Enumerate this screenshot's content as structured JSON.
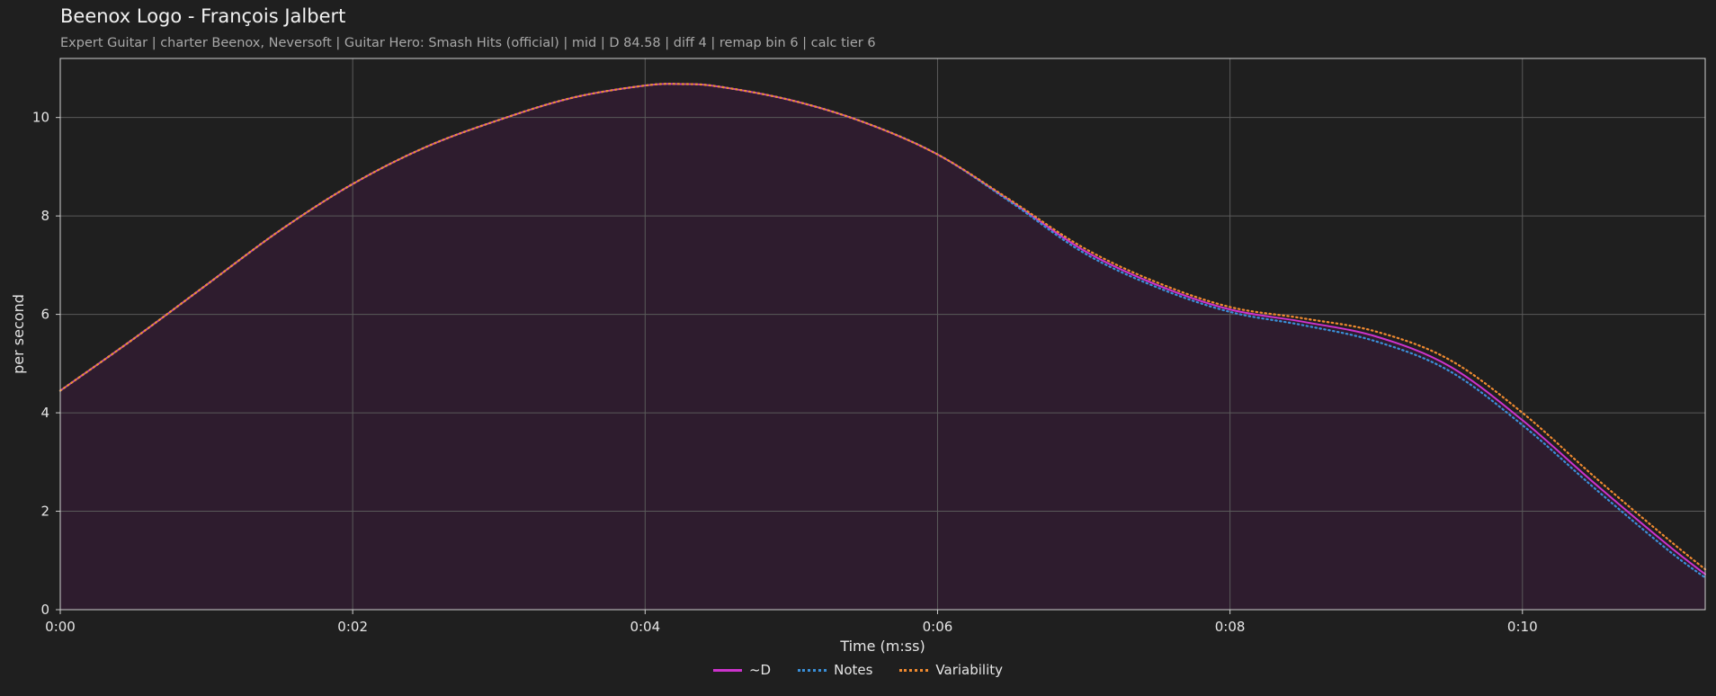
{
  "header": {
    "title": "Beenox Logo - François Jalbert",
    "subtitle": "Expert Guitar  |  charter Beenox,  Neversoft  |  Guitar Hero: Smash Hits (official)  |  mid  |  D 84.58  |  diff 4  |  remap bin 6  |  calc tier 6"
  },
  "chart_data": {
    "type": "line",
    "xlabel": "Time (m:ss)",
    "ylabel": "per second",
    "xlim": [
      0,
      11.25
    ],
    "ylim": [
      0,
      11.2
    ],
    "x_ticks": [
      0,
      2,
      4,
      6,
      8,
      10
    ],
    "x_tick_labels": [
      "0:00",
      "0:02",
      "0:04",
      "0:06",
      "0:08",
      "0:10"
    ],
    "y_ticks": [
      0,
      2,
      4,
      6,
      8,
      10
    ],
    "grid": true,
    "legend_position": "bottom-center",
    "x": [
      0,
      0.5,
      1,
      1.5,
      2,
      2.5,
      3,
      3.5,
      4,
      4.25,
      4.5,
      5,
      5.5,
      6,
      6.5,
      7,
      7.5,
      8,
      8.5,
      9,
      9.5,
      10,
      10.5,
      11,
      11.25
    ],
    "series": [
      {
        "name": "~D",
        "color": "#cc33cc",
        "style": "solid",
        "values": [
          4.45,
          5.5,
          6.6,
          7.7,
          8.65,
          9.4,
          9.95,
          10.4,
          10.65,
          10.68,
          10.63,
          10.35,
          9.9,
          9.25,
          8.3,
          7.3,
          6.6,
          6.1,
          5.85,
          5.55,
          4.95,
          3.85,
          2.55,
          1.3,
          0.72
        ]
      },
      {
        "name": "Notes",
        "color": "#3a8fd8",
        "style": "dotted",
        "values": [
          4.45,
          5.5,
          6.6,
          7.7,
          8.65,
          9.4,
          9.95,
          10.4,
          10.65,
          10.68,
          10.63,
          10.35,
          9.9,
          9.25,
          8.28,
          7.25,
          6.55,
          6.05,
          5.78,
          5.45,
          4.85,
          3.75,
          2.45,
          1.2,
          0.65
        ]
      },
      {
        "name": "Variability",
        "color": "#f08a30",
        "style": "dotted",
        "values": [
          4.45,
          5.5,
          6.6,
          7.7,
          8.65,
          9.4,
          9.95,
          10.4,
          10.65,
          10.68,
          10.63,
          10.35,
          9.9,
          9.25,
          8.32,
          7.35,
          6.65,
          6.15,
          5.92,
          5.65,
          5.08,
          4.0,
          2.68,
          1.42,
          0.82
        ]
      }
    ],
    "fill_color": "#2e1c2e"
  }
}
